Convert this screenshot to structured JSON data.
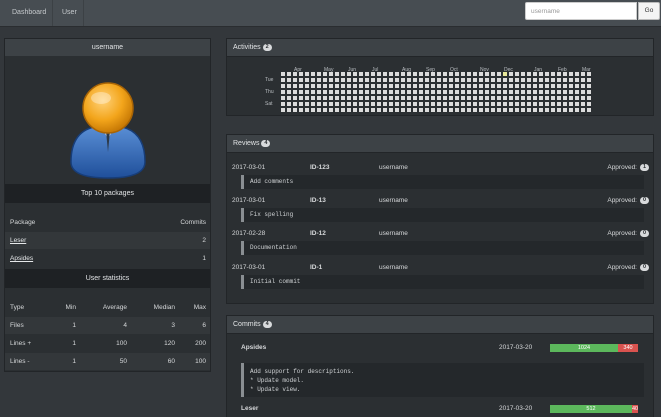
{
  "nav": {
    "items": [
      "Dashboard",
      "User"
    ],
    "search_placeholder": "username",
    "go_label": "Go"
  },
  "profile": {
    "username": "username",
    "top_packages": {
      "title": "Top 10 packages",
      "headers": [
        "Package",
        "Commits"
      ],
      "rows": [
        {
          "name": "Leser",
          "commits": "2"
        },
        {
          "name": "Apsides",
          "commits": "1"
        }
      ]
    },
    "user_statistics": {
      "title": "User statistics",
      "headers": [
        "Type",
        "Min",
        "Average",
        "Median",
        "Max"
      ],
      "rows": [
        [
          "Files",
          "1",
          "4",
          "3",
          "6"
        ],
        [
          "Lines +",
          "1",
          "100",
          "120",
          "200"
        ],
        [
          "Lines -",
          "1",
          "50",
          "60",
          "100"
        ]
      ]
    }
  },
  "activities": {
    "title": "Activities",
    "count": "2",
    "months": [
      "Apr",
      "May",
      "Jun",
      "Jul",
      "Aug",
      "Sep",
      "Oct",
      "Nov",
      "Dec",
      "Jan",
      "Feb",
      "Mar"
    ],
    "days": [
      "Tue",
      "Thu",
      "Sat"
    ]
  },
  "reviews": {
    "title": "Reviews",
    "count": "4",
    "approved_label": "Approved:",
    "items": [
      {
        "date": "2017-03-01",
        "id": "ID-123",
        "user": "username",
        "approved": "1",
        "message": "Add comments"
      },
      {
        "date": "2017-03-01",
        "id": "ID-13",
        "user": "username",
        "approved": "0",
        "message": "Fix spelling"
      },
      {
        "date": "2017-02-28",
        "id": "ID-12",
        "user": "username",
        "approved": "0",
        "message": "Documentation"
      },
      {
        "date": "2017-03-01",
        "id": "ID-1",
        "user": "username",
        "approved": "0",
        "message": "Initial commit"
      }
    ]
  },
  "commits": {
    "title": "Commits",
    "count": "4",
    "items": [
      {
        "package": "Apsides",
        "date": "2017-03-20",
        "added": "1024",
        "removed": "340",
        "message_lines": [
          "Add support for descriptions.",
          "* Update model.",
          "* Update view."
        ]
      },
      {
        "package": "Leser",
        "date": "2017-03-20",
        "added": "512",
        "removed": "40"
      }
    ]
  }
}
